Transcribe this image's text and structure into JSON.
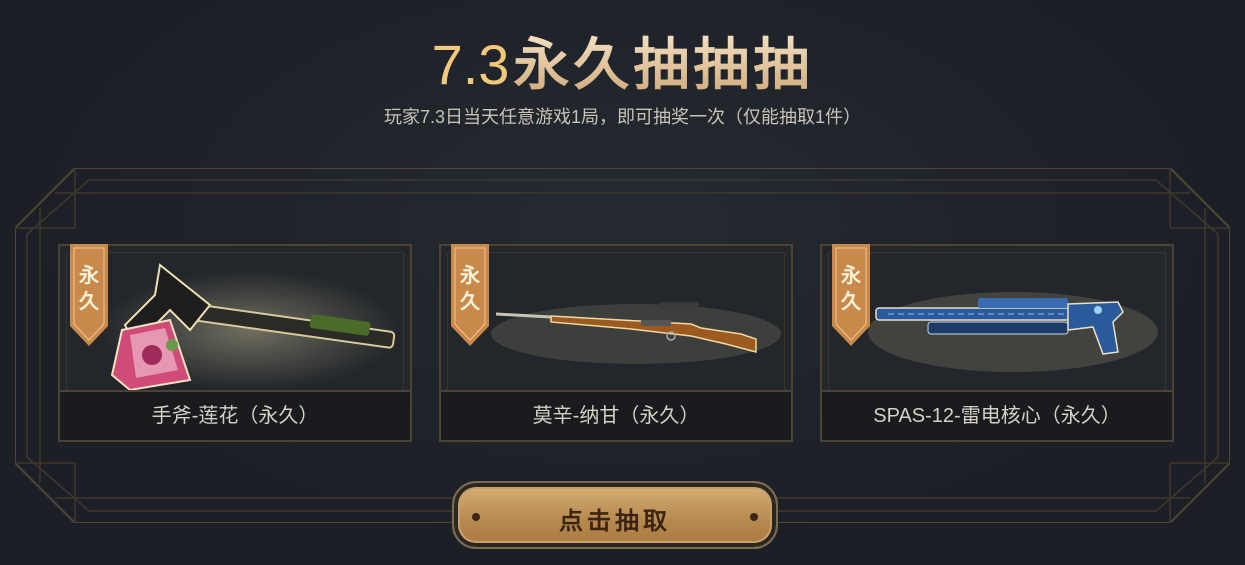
{
  "header": {
    "title_number": "7.3",
    "title_text": "永久抽抽抽",
    "subtitle": "玩家7.3日当天任意游戏1局，即可抽奖一次（仅能抽取1件）"
  },
  "prizes": [
    {
      "badge": "永久",
      "name": "手斧-莲花（永久）",
      "icon": "hand-axe-icon"
    },
    {
      "badge": "永久",
      "name": "莫辛-纳甘（永久）",
      "icon": "rifle-icon"
    },
    {
      "badge": "永久",
      "name": "SPAS-12-雷电核心（永久）",
      "icon": "shotgun-icon"
    }
  ],
  "draw_button": {
    "label": "点击抽取"
  },
  "colors": {
    "background": "#1c1f25",
    "gold": "#e8c89a",
    "ribbon": "#c8894a",
    "button": "#c9a066",
    "card_border": "#4b4335"
  }
}
